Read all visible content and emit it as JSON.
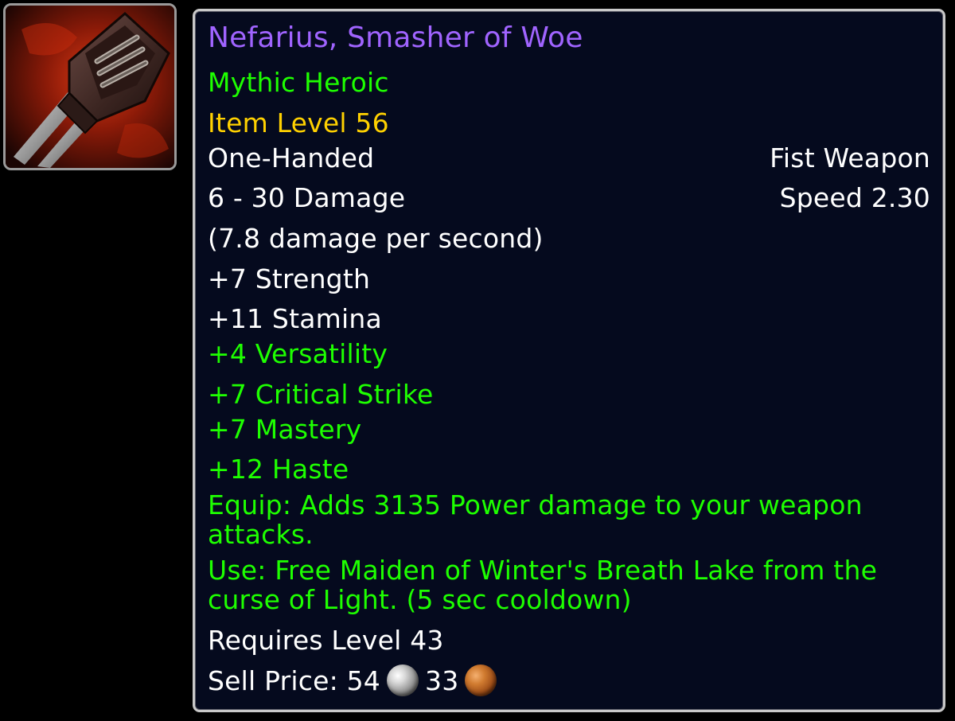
{
  "item": {
    "icon": "fist-weapon-icon",
    "name": "Nefarius, Smasher of Woe",
    "difficulty": "Mythic Heroic",
    "item_level": "Item Level 56",
    "slot": "One-Handed",
    "weapon_type": "Fist Weapon",
    "damage": "6 - 30 Damage",
    "speed": "Speed 2.30",
    "dps": "(7.8 damage per second)",
    "primary_stats": [
      "+7 Strength",
      "+11 Stamina"
    ],
    "secondary_stats": [
      "+4 Versatility",
      "+7 Critical Strike",
      "+7 Mastery",
      "+12 Haste"
    ],
    "equip_effect": "Equip: Adds 3135 Power damage to your weapon attacks.",
    "use_effect": "Use: Free Maiden of Winter's Breath Lake from the curse of Light. (5 sec cooldown)",
    "required_level": "Requires Level 43",
    "sell_price": {
      "label": "Sell Price:",
      "silver": "54",
      "copper": "33"
    }
  },
  "colors": {
    "name": "#a064ff",
    "green_text": "#1eff00",
    "item_level": "#ffd100",
    "white_text": "#ffffff",
    "tooltip_bg": "#050a1e",
    "border": "#c9c9c9"
  }
}
